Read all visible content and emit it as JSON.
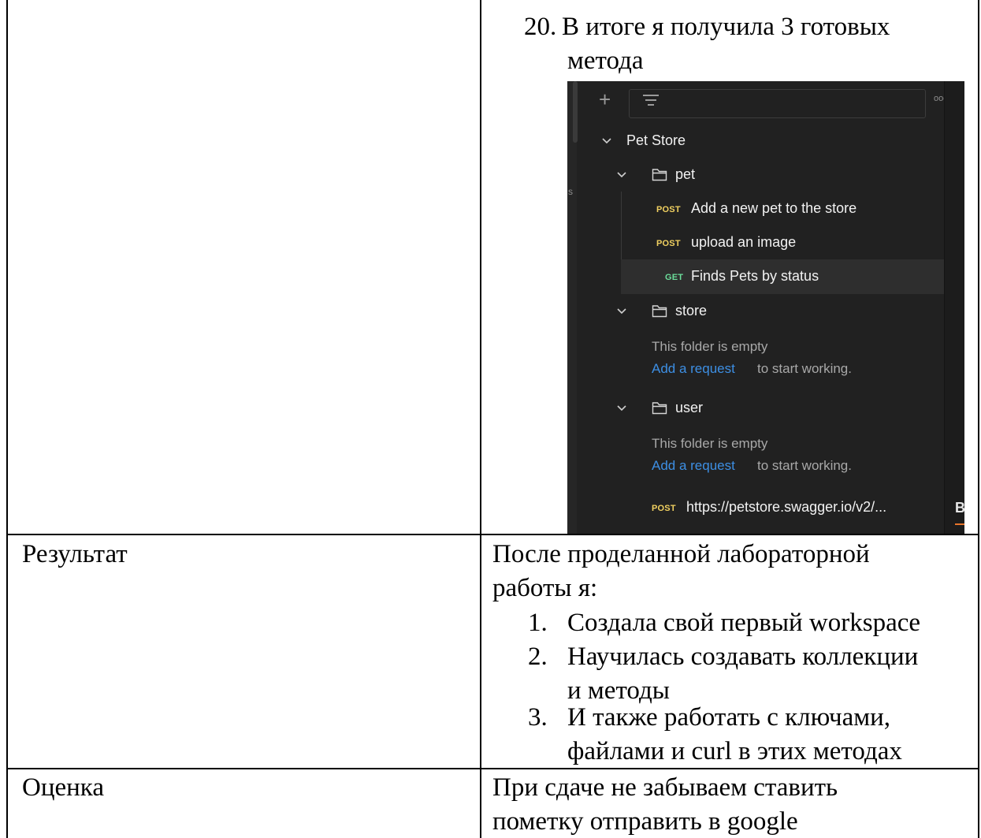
{
  "document": {
    "row1": {
      "step_number": "20.",
      "step_text_line1": "В итоге я получила 3 готовых",
      "step_text_line2": "метода"
    },
    "row2": {
      "label": "Результат",
      "intro_line1": "После проделанной лабораторной",
      "intro_line2": "работы я:",
      "list": [
        {
          "num": "1.",
          "lines": [
            "Создала свой первый workspace"
          ]
        },
        {
          "num": "2.",
          "lines": [
            "Научилась создавать коллекции",
            "и методы"
          ]
        },
        {
          "num": "3.",
          "lines": [
            "И также работать с ключами,",
            "файлами и curl в этих методах"
          ]
        }
      ]
    },
    "row3": {
      "label": "Оценка",
      "text_line1": "При сдаче не забываем ставить",
      "text_line2": "пометку отправить в google"
    }
  },
  "screenshot": {
    "collection_name": "Pet Store",
    "folders": [
      {
        "name": "pet"
      },
      {
        "name": "store",
        "empty_text": "This folder is empty",
        "add_link": "Add a request",
        "add_suffix": "to start working."
      },
      {
        "name": "user",
        "empty_text": "This folder is empty",
        "add_link": "Add a request",
        "add_suffix": "to start working."
      }
    ],
    "requests": [
      {
        "method": "POST",
        "name": "Add a new pet to the store"
      },
      {
        "method": "POST",
        "name": "upload an image"
      },
      {
        "method": "GET",
        "name": "Finds Pets by status"
      }
    ],
    "loose_request": {
      "method": "POST",
      "name": "https://petstore.swagger.io/v2/..."
    },
    "more_glyph": "ooo",
    "plus_glyph": "+",
    "stray_letter": "s",
    "right_panel_letter": "B",
    "colors": {
      "post": "#f0d060",
      "get": "#6bdd9a",
      "link": "#3d8fe4",
      "background": "#212121"
    },
    "icons": [
      "plus-icon",
      "filter-icon",
      "more-icon",
      "chevron-down-icon",
      "folder-icon"
    ]
  }
}
